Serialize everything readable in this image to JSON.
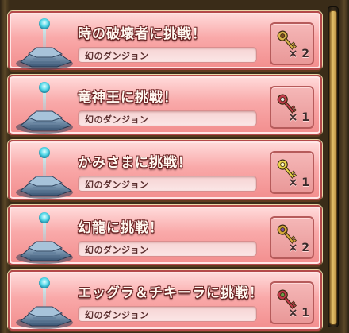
{
  "dungeon_list": {
    "items": [
      {
        "title": "時の破壊者に挑戦！",
        "subtitle": "幻のダンジョン",
        "key_icon": "gold-key-icon",
        "key_color": "#d8b24a",
        "key_gem": "#7a4a20",
        "count": "× 2"
      },
      {
        "title": "竜神王に挑戦！",
        "subtitle": "幻のダンジョン",
        "key_icon": "red-key-icon",
        "key_color": "#c0394a",
        "key_gem": "#e8e0e0",
        "count": "× 1"
      },
      {
        "title": "かみさまに挑戦！",
        "subtitle": "幻のダンジョン",
        "key_icon": "yellow-key-icon",
        "key_color": "#e8d34a",
        "key_gem": "#fff7c0",
        "count": "× 1"
      },
      {
        "title": "幻龍に挑戦！",
        "subtitle": "幻のダンジョン",
        "key_icon": "purple-key-icon",
        "key_color": "#d6a83a",
        "key_gem": "#7a4a9a",
        "count": "× 2"
      },
      {
        "title": "エッグラ＆チキーラに挑戦！",
        "subtitle": "幻のダンジョン",
        "key_icon": "rose-key-icon",
        "key_color": "#c0394a",
        "key_gem": "#6aa04a",
        "count": "× 1"
      }
    ]
  },
  "colors": {
    "card_top": "#ffdcdc",
    "card_bottom": "#f28e8e",
    "card_border": "#b4494a",
    "scroll_thumb": "#e4c06a"
  }
}
